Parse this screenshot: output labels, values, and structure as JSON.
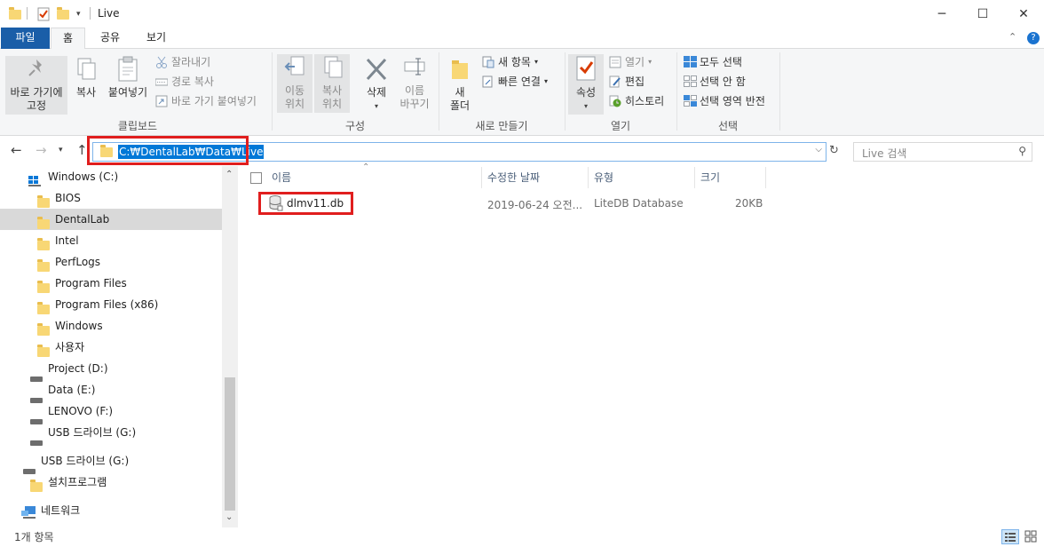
{
  "window": {
    "title": "Live",
    "minimize": "─",
    "maximize": "☐",
    "close": "✕"
  },
  "tabs": [
    "파일",
    "홈",
    "공유",
    "보기"
  ],
  "ribbon": {
    "clipboard": {
      "label": "클립보드",
      "pin": "바로 가기에\n고정",
      "copy": "복사",
      "paste": "붙여넣기",
      "cut": "잘라내기",
      "copy_path": "경로 복사",
      "paste_shortcut": "바로 가기 붙여넣기"
    },
    "organize": {
      "label": "구성",
      "move_to": "이동\n위치",
      "copy_to": "복사\n위치",
      "delete": "삭제",
      "rename": "이름\n바꾸기"
    },
    "new": {
      "label": "새로 만들기",
      "new_folder": "새\n폴더",
      "new_item": "새 항목",
      "easy_access": "빠른 연결"
    },
    "open": {
      "label": "열기",
      "properties": "속성",
      "open": "열기",
      "edit": "편집",
      "history": "히스토리"
    },
    "select": {
      "label": "선택",
      "select_all": "모두 선택",
      "select_none": "선택 안 함",
      "invert": "선택 영역 반전"
    }
  },
  "address": {
    "path": "C:₩DentalLab₩Data₩Live",
    "search_placeholder": "Live 검색"
  },
  "nav": [
    {
      "label": "Windows (C:)",
      "kind": "drive-win"
    },
    {
      "label": "BIOS",
      "kind": "folder"
    },
    {
      "label": "DentalLab",
      "kind": "folder",
      "selected": true
    },
    {
      "label": "Intel",
      "kind": "folder"
    },
    {
      "label": "PerfLogs",
      "kind": "folder"
    },
    {
      "label": "Program Files",
      "kind": "folder"
    },
    {
      "label": "Program Files (x86)",
      "kind": "folder"
    },
    {
      "label": "Windows",
      "kind": "folder"
    },
    {
      "label": "사용자",
      "kind": "folder"
    },
    {
      "label": "Project (D:)",
      "kind": "drive"
    },
    {
      "label": "Data (E:)",
      "kind": "drive"
    },
    {
      "label": "LENOVO (F:)",
      "kind": "drive"
    },
    {
      "label": "USB 드라이브 (G:)",
      "kind": "drive"
    },
    {
      "label": "USB 드라이브 (G:)",
      "kind": "drive"
    },
    {
      "label": "설치프로그램",
      "kind": "folder"
    },
    {
      "label": "네트워크",
      "kind": "network"
    }
  ],
  "columns": {
    "name": "이름",
    "modified": "수정한 날짜",
    "type": "유형",
    "size": "크기"
  },
  "files": [
    {
      "name": "dlmv11.db",
      "modified": "2019-06-24 오전...",
      "type": "LiteDB Database",
      "size": "20KB"
    }
  ],
  "status": {
    "count": "1개 항목"
  },
  "colors": {
    "accent": "#1a5ea8",
    "selection": "#0078d7",
    "highlight_box": "#e01e1e",
    "folder": "#f8d775"
  }
}
